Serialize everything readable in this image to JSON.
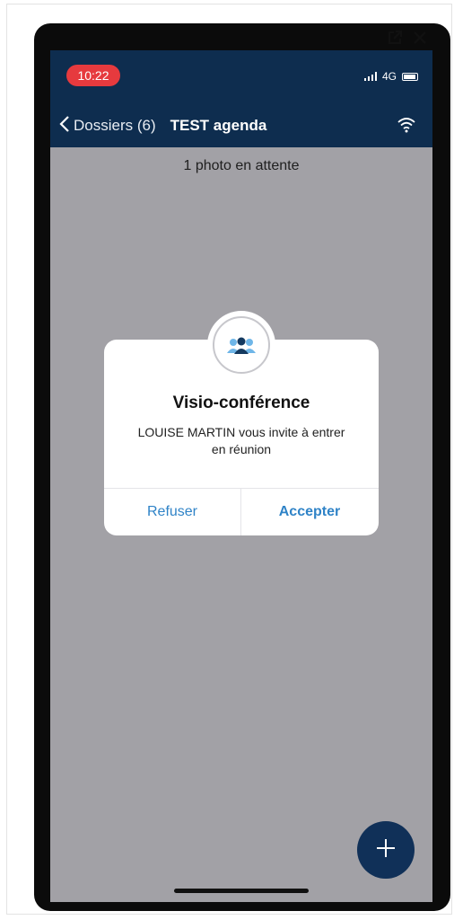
{
  "status_bar": {
    "time": "10:22",
    "network": "4G"
  },
  "nav": {
    "back_label": "Dossiers (6)",
    "title": "TEST agenda"
  },
  "content": {
    "pending_text": "1 photo en attente"
  },
  "dialog": {
    "title": "Visio-conférence",
    "message": "LOUISE MARTIN vous invite à entrer en réunion",
    "refuse_label": "Refuser",
    "accept_label": "Accepter"
  },
  "icons": {
    "window_external": "external-link-icon",
    "window_close": "close-icon",
    "back": "chevron-left-icon",
    "wifi": "wifi-icon",
    "dialog_badge": "video-conference-icon",
    "fab": "plus-icon"
  },
  "colors": {
    "nav_background": "#0e2d4f",
    "time_pill": "#e63a3e",
    "screen_background": "#a2a1a6",
    "dialog_button_text": "#2f83c7",
    "fab_background": "#103058"
  }
}
